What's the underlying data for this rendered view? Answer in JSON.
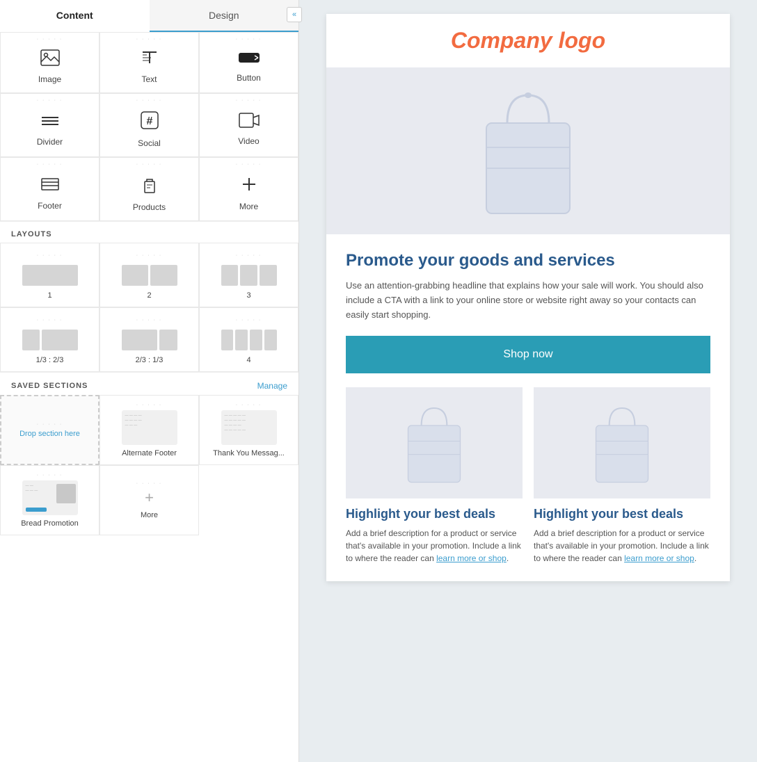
{
  "panel": {
    "collapse_icon": "«",
    "tabs": [
      {
        "id": "content",
        "label": "Content",
        "active": true
      },
      {
        "id": "design",
        "label": "Design",
        "active": false
      }
    ],
    "blocks": [
      {
        "id": "image",
        "label": "Image",
        "icon": "🖼"
      },
      {
        "id": "text",
        "label": "Text",
        "icon": "📝"
      },
      {
        "id": "button",
        "label": "Button",
        "icon": "🔲"
      },
      {
        "id": "divider",
        "label": "Divider",
        "icon": "≡"
      },
      {
        "id": "social",
        "label": "Social",
        "icon": "#"
      },
      {
        "id": "video",
        "label": "Video",
        "icon": "▶"
      },
      {
        "id": "footer",
        "label": "Footer",
        "icon": "≡"
      },
      {
        "id": "products",
        "label": "Products",
        "icon": "📦"
      },
      {
        "id": "more",
        "label": "More",
        "icon": "+"
      }
    ],
    "layouts_label": "LAYOUTS",
    "layouts": [
      {
        "id": "1",
        "label": "1",
        "cols": [
          1
        ]
      },
      {
        "id": "2",
        "label": "2",
        "cols": [
          2
        ]
      },
      {
        "id": "3",
        "label": "3",
        "cols": [
          3
        ]
      },
      {
        "id": "1/3-2/3",
        "label": "1/3 : 2/3",
        "cols": "thirds-left"
      },
      {
        "id": "2/3-1/3",
        "label": "2/3 : 1/3",
        "cols": "thirds-right"
      },
      {
        "id": "4",
        "label": "4",
        "cols": [
          4
        ]
      }
    ],
    "saved_sections_label": "SAVED SECTIONS",
    "manage_label": "Manage",
    "saved_sections": [
      {
        "id": "drop",
        "label": "Drop section here",
        "type": "drop"
      },
      {
        "id": "alt-footer",
        "label": "Alternate Footer",
        "type": "preview-text"
      },
      {
        "id": "thank-you",
        "label": "Thank You Messag...",
        "type": "preview-text"
      },
      {
        "id": "bread-promo",
        "label": "Bread Promotion",
        "type": "preview-image"
      },
      {
        "id": "more",
        "label": "More",
        "type": "plus"
      }
    ]
  },
  "email": {
    "company_logo": "Company logo",
    "headline": "Promote your goods and services",
    "body_text": "Use an attention-grabbing headline that explains how your sale will work. You should also include a CTA with a link to your online store or website right away so your contacts can easily start shopping.",
    "shop_now_label": "Shop now",
    "products": [
      {
        "title": "Highlight your best deals",
        "desc": "Add a brief description for a product or service that's available in your promotion. Include a link to where the reader can",
        "link_text": "learn more or shop",
        "link_suffix": "."
      },
      {
        "title": "Highlight your best deals",
        "desc": "Add a brief description for a product or service that's available in your promotion. Include a link to where the reader can",
        "link_text": "learn more or shop",
        "link_suffix": "."
      }
    ]
  }
}
